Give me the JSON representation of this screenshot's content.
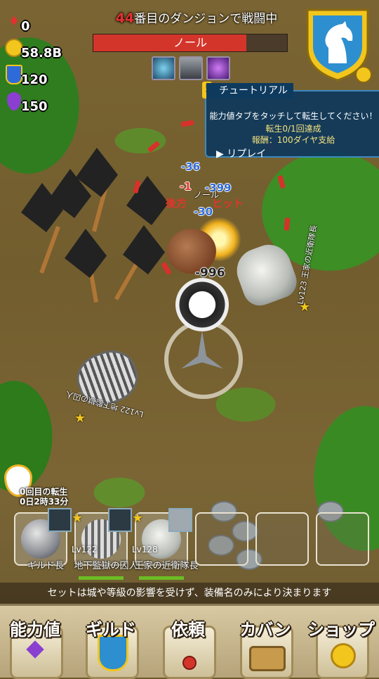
{
  "resources": {
    "gems": "0",
    "gold": "58.8B",
    "trophy": "120",
    "elixir": "150"
  },
  "battle": {
    "dungeon_num": "44",
    "title_suffix": "番目のダンジョンで戦闘中",
    "boss_name": "ノール",
    "boss_hp_fraction": 0.79,
    "skills": [
      "spiral-skill-icon",
      "helmet-skill-icon",
      "magic-skill-icon"
    ]
  },
  "tutorial": {
    "header": "チュートリアル",
    "line1": "能力値タブをタッチして転生してください！",
    "line2": "転生0/1回達成",
    "line3": "報酬：100ダイヤ支給",
    "replay": "リプレイ"
  },
  "floating": {
    "d1": "-36",
    "d2": "-1",
    "d3": "-399",
    "d4": "-30",
    "d5": "-996",
    "boss_label": "ノール",
    "rear": "後方",
    "hit": "ヒット"
  },
  "enemies": {
    "right_label": "Lv123 王家の近衛隊長",
    "left_label": "Lv122 地下監獄の囚人"
  },
  "rebirth": {
    "count": "0回目の転生",
    "time": "0日2時33分"
  },
  "party": [
    {
      "name": "ギルド長",
      "level": ""
    },
    {
      "name": "地下監獄の囚人",
      "level": "Lv122"
    },
    {
      "name": "王家の近衛隊長",
      "level": "Lv128"
    }
  ],
  "info_text": "セットは城や等級の影響を受けず、装備名のみにより決まります",
  "menu": {
    "stats": "能力値",
    "guild": "ギルド",
    "quest": "依頼",
    "bag": "カバン",
    "shop": "ショップ"
  },
  "colors": {
    "hp_bar": "#d4352b",
    "tutorial_bg": "#0e385c",
    "accent_gold": "#f2c61c"
  }
}
